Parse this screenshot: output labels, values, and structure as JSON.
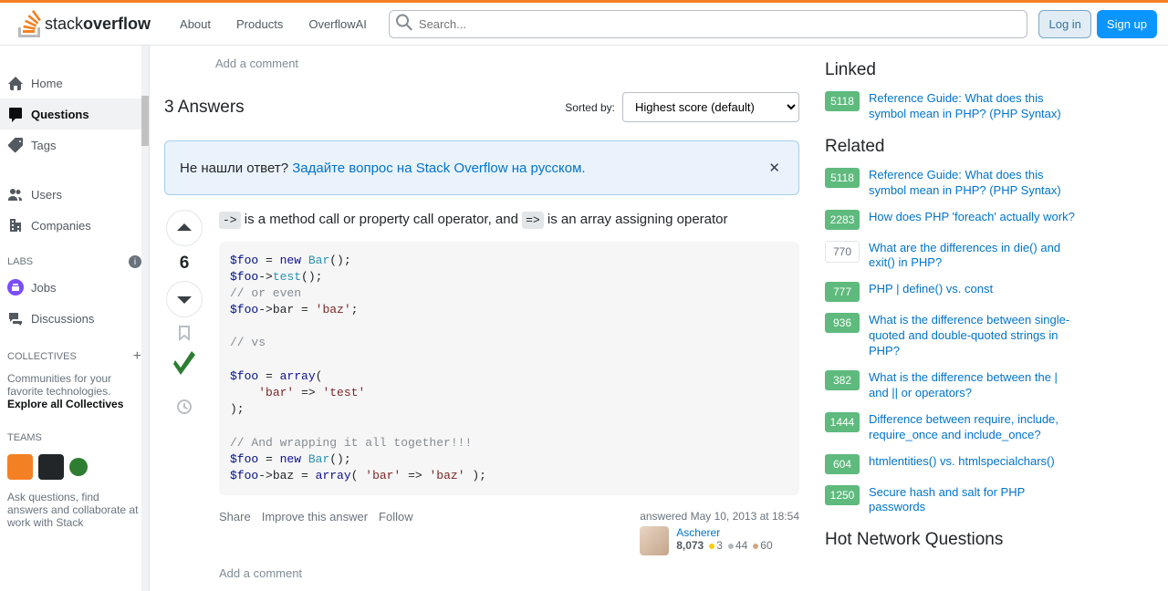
{
  "header": {
    "logo_text_1": "stack",
    "logo_text_2": "overflow",
    "nav": {
      "about": "About",
      "products": "Products",
      "overflowai": "OverflowAI"
    },
    "search_placeholder": "Search...",
    "login": "Log in",
    "signup": "Sign up"
  },
  "sidebar": {
    "home": "Home",
    "questions": "Questions",
    "tags": "Tags",
    "users": "Users",
    "companies": "Companies",
    "labs": "LABS",
    "jobs": "Jobs",
    "discussions": "Discussions",
    "collectives": "COLLECTIVES",
    "collectives_sub": "Communities for your favorite technologies.",
    "collectives_link": "Explore all Collectives",
    "teams": "TEAMS",
    "teams_sub": "Ask questions, find answers and collaborate at work with Stack"
  },
  "main": {
    "add_comment": "Add a comment",
    "answers_count": "3 Answers",
    "sorted_by": "Sorted by:",
    "sort_value": "Highest score (default)",
    "notice_text": "Не нашли ответ? ",
    "notice_link": "Задайте вопрос на Stack Overflow на русском.",
    "answer": {
      "score": "6",
      "text_1": "is a method call or property call operator, and",
      "text_2": "is an array assigning operator",
      "code_op1": "->",
      "code_op2": "=>",
      "actions": {
        "share": "Share",
        "improve": "Improve this answer",
        "follow": "Follow"
      },
      "answered": "answered May 10, 2013 at 18:54",
      "user": "Ascherer",
      "rep": "8,073",
      "gold": "3",
      "silver": "44",
      "bronze": "60"
    }
  },
  "linked": {
    "heading": "Linked",
    "items": [
      {
        "score": "5118",
        "text": "Reference Guide: What does this symbol mean in PHP? (PHP Syntax)"
      }
    ]
  },
  "related": {
    "heading": "Related",
    "items": [
      {
        "score": "5118",
        "text": "Reference Guide: What does this symbol mean in PHP? (PHP Syntax)"
      },
      {
        "score": "2283",
        "text": "How does PHP 'foreach' actually work?"
      },
      {
        "score": "770",
        "low": true,
        "text": "What are the differences in die() and exit() in PHP?"
      },
      {
        "score": "777",
        "text": "PHP | define() vs. const"
      },
      {
        "score": "936",
        "text": "What is the difference between single-quoted and double-quoted strings in PHP?"
      },
      {
        "score": "382",
        "text": "What is the difference between the | and || or operators?"
      },
      {
        "score": "1444",
        "text": "Difference between require, include, require_once and include_once?"
      },
      {
        "score": "604",
        "text": "htmlentities() vs. htmlspecialchars()"
      },
      {
        "score": "1250",
        "text": "Secure hash and salt for PHP passwords"
      }
    ]
  },
  "hot": {
    "heading": "Hot Network Questions"
  }
}
